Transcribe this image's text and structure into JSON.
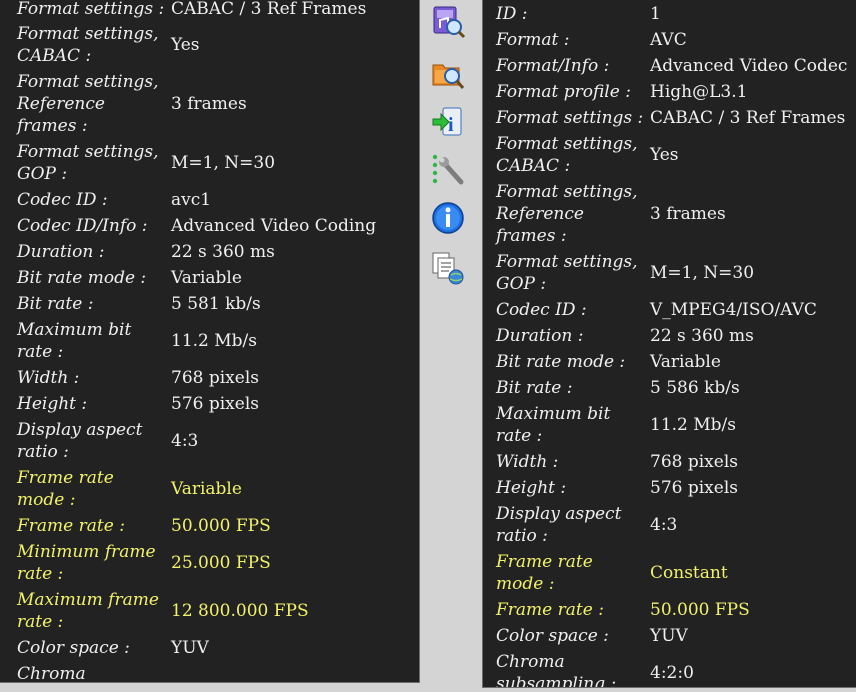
{
  "left_panel": {
    "rows": [
      {
        "label": "Format settings :",
        "value": "CABAC / 3 Ref Frames",
        "highlight": false
      },
      {
        "label": "Format settings,\nCABAC :",
        "value": "Yes",
        "highlight": false
      },
      {
        "label": "Format settings,\nReference\nframes :",
        "value": "3 frames",
        "highlight": false
      },
      {
        "label": "Format settings,\nGOP :",
        "value": "M=1, N=30",
        "highlight": false
      },
      {
        "label": "Codec ID :",
        "value": "avc1",
        "highlight": false
      },
      {
        "label": "Codec ID/Info :",
        "value": "Advanced Video Coding",
        "highlight": false
      },
      {
        "label": "Duration :",
        "value": "22 s 360 ms",
        "highlight": false
      },
      {
        "label": "Bit rate mode :",
        "value": "Variable",
        "highlight": false
      },
      {
        "label": "Bit rate :",
        "value": "5 581 kb/s",
        "highlight": false
      },
      {
        "label": "Maximum bit\nrate :",
        "value": "11.2 Mb/s",
        "highlight": false
      },
      {
        "label": "Width :",
        "value": "768 pixels",
        "highlight": false
      },
      {
        "label": "Height :",
        "value": "576 pixels",
        "highlight": false
      },
      {
        "label": "Display aspect\nratio :",
        "value": "4:3",
        "highlight": false
      },
      {
        "label": "Frame rate\nmode :",
        "value": "Variable",
        "highlight": true
      },
      {
        "label": "Frame rate :",
        "value": "50.000 FPS",
        "highlight": true
      },
      {
        "label": "Minimum frame\nrate :",
        "value": "25.000 FPS",
        "highlight": true
      },
      {
        "label": "Maximum frame\nrate :",
        "value": "12 800.000 FPS",
        "highlight": true
      },
      {
        "label": "Color space :",
        "value": "YUV",
        "highlight": false
      },
      {
        "label": "Chroma",
        "value": "",
        "highlight": false
      }
    ]
  },
  "right_panel": {
    "rows": [
      {
        "label": "ID :",
        "value": "1",
        "highlight": false
      },
      {
        "label": "Format :",
        "value": "AVC",
        "highlight": false
      },
      {
        "label": "Format/Info :",
        "value": "Advanced Video Codec",
        "highlight": false
      },
      {
        "label": "Format profile :",
        "value": "High@L3.1",
        "highlight": false
      },
      {
        "label": "Format settings :",
        "value": "CABAC / 3 Ref Frames",
        "highlight": false
      },
      {
        "label": "Format settings,\nCABAC :",
        "value": "Yes",
        "highlight": false
      },
      {
        "label": "Format settings,\nReference\nframes :",
        "value": "3 frames",
        "highlight": false
      },
      {
        "label": "Format settings,\nGOP :",
        "value": "M=1, N=30",
        "highlight": false
      },
      {
        "label": "Codec ID :",
        "value": "V_MPEG4/ISO/AVC",
        "highlight": false
      },
      {
        "label": "Duration :",
        "value": "22 s 360 ms",
        "highlight": false
      },
      {
        "label": "Bit rate mode :",
        "value": "Variable",
        "highlight": false
      },
      {
        "label": "Bit rate :",
        "value": "5 586 kb/s",
        "highlight": false
      },
      {
        "label": "Maximum bit\nrate :",
        "value": "11.2 Mb/s",
        "highlight": false
      },
      {
        "label": "Width :",
        "value": "768 pixels",
        "highlight": false
      },
      {
        "label": "Height :",
        "value": "576 pixels",
        "highlight": false
      },
      {
        "label": "Display aspect\nratio :",
        "value": "4:3",
        "highlight": false
      },
      {
        "label": "Frame rate\nmode :",
        "value": "Constant",
        "highlight": true
      },
      {
        "label": "Frame rate :",
        "value": "50.000 FPS",
        "highlight": true
      },
      {
        "label": "Color space :",
        "value": "YUV",
        "highlight": false
      },
      {
        "label": "Chroma\nsubsampling :",
        "value": "4:2:0",
        "highlight": false
      }
    ]
  },
  "toolbar": {
    "icons": [
      "music-video-search-icon",
      "folder-search-icon",
      "export-info-icon",
      "tools-wrench-icon",
      "info-icon",
      "documents-globe-icon"
    ]
  },
  "colors": {
    "panel_bg": "#222222",
    "text": "#f0f0f0",
    "highlight_text": "#f2f26a",
    "chrome": "#d4d4d4"
  }
}
